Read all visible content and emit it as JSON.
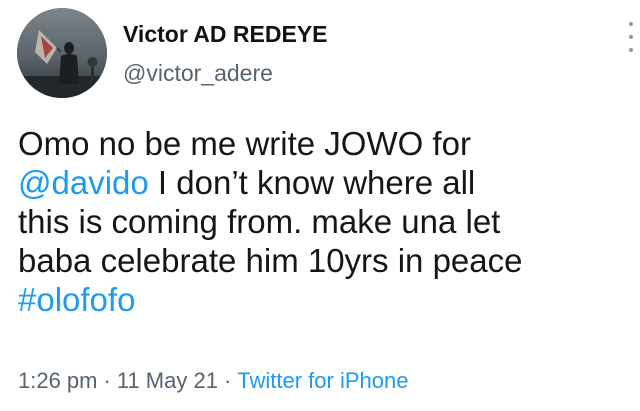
{
  "author": {
    "display_name": "Victor AD REDEYE",
    "handle": "@victor_adere",
    "avatar_icon": "profile-photo"
  },
  "tweet": {
    "line1": "Omo no be me write JOWO for",
    "mention": "@davido",
    "line2_rest": " I don’t know where all",
    "line3": "this is coming from. make una let",
    "line4": "baba celebrate him 10yrs in peace",
    "hashtag": "#olofofo"
  },
  "meta": {
    "time": "1:26 pm",
    "separator": "·",
    "date": "11 May 21",
    "source": "Twitter for iPhone"
  },
  "menu": {
    "icon": "more-vertical-icon"
  },
  "colors": {
    "link": "#1d9bf0",
    "text": "#14171a",
    "secondary": "#566370"
  }
}
